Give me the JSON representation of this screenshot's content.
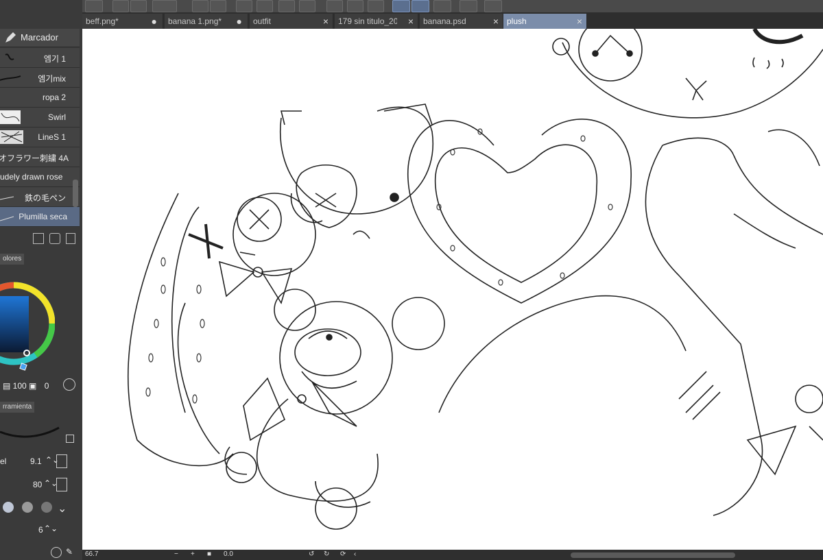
{
  "tabs": [
    {
      "label": "beff.png*",
      "marker": "●"
    },
    {
      "label": "banana 1.png*",
      "marker": "●"
    },
    {
      "label": "outfit",
      "marker": "×"
    },
    {
      "label": "179 sin titulo_20",
      "marker": "×"
    },
    {
      "label": "banana.psd",
      "marker": "×"
    },
    {
      "label": "plush",
      "marker": "×"
    }
  ],
  "brush_panel": {
    "title": "Marcador",
    "items": [
      "엠기 1",
      "엠기mix",
      "ropa 2",
      "Swirl",
      "LineS 1",
      "オフラワー刺繍 4A",
      "udely drawn rose",
      "鉄の毛ペン",
      "Plumilla seca"
    ]
  },
  "color_panel": {
    "label": "olores",
    "opacity_value": "100",
    "extra_value": "0"
  },
  "tool_panel": {
    "label": "rramienta",
    "size_label": "el",
    "size_value": "9.1",
    "opacity_value": "80",
    "stab_value": "6"
  },
  "status": {
    "zoom": "66.7",
    "angle": "0.0",
    "minus": "−",
    "plus": "+"
  },
  "colors": {
    "accent": "#7b8daa",
    "panel": "#3a3a3a",
    "canvas": "#ffffff"
  }
}
